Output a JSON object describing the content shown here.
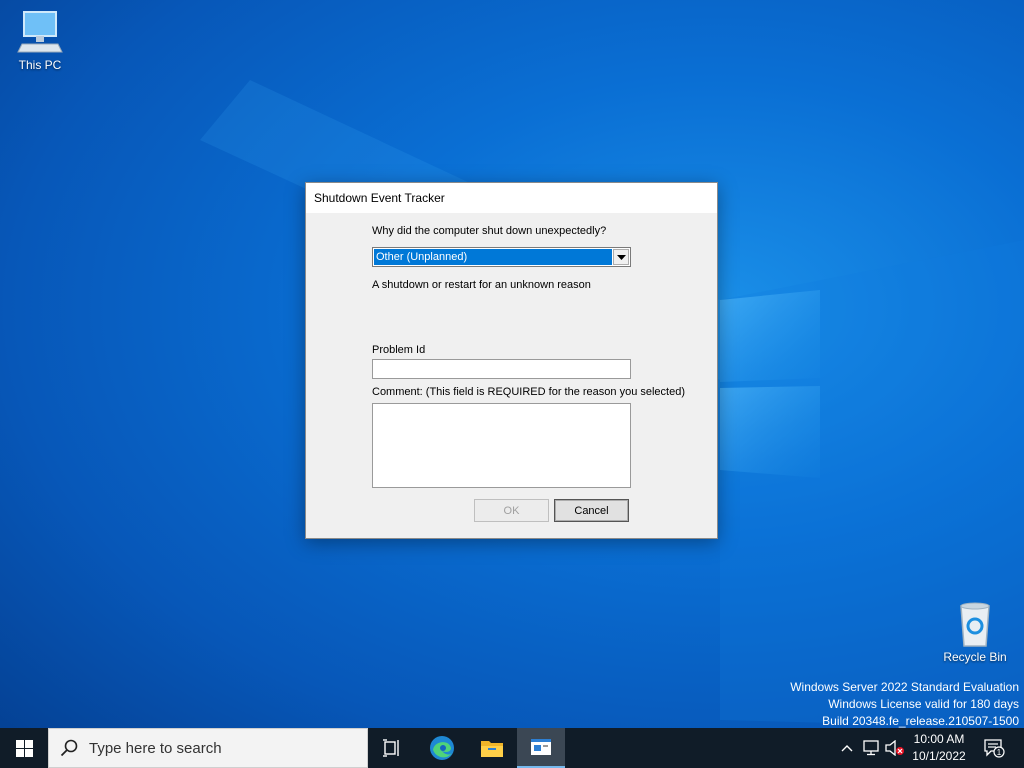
{
  "desktop": {
    "icons": [
      {
        "label": "This PC"
      },
      {
        "label": "Recycle Bin"
      }
    ],
    "watermark": [
      "Windows Server 2022 Standard Evaluation",
      "Windows License valid for 180 days",
      "Build 20348.fe_release.210507-1500"
    ]
  },
  "dialog": {
    "title": "Shutdown Event Tracker",
    "question": "Why did the computer shut down unexpectedly?",
    "reason_selected": "Other (Unplanned)",
    "reason_description": "A shutdown or restart for an unknown reason",
    "problem_id_label": "Problem Id",
    "problem_id_value": "",
    "comment_label": "Comment: (This field is REQUIRED for the reason you selected)",
    "comment_value": "",
    "ok_label": "OK",
    "cancel_label": "Cancel"
  },
  "taskbar": {
    "search_placeholder": "Type here to search",
    "apps": [
      "task-view-icon",
      "edge-icon",
      "file-explorer-icon",
      "shutdown-tracker-icon"
    ],
    "tray_icons": [
      "chevron-up-icon",
      "network-icon",
      "volume-muted-icon"
    ],
    "time": "10:00 AM",
    "date": "10/1/2022",
    "notification_count": "1"
  },
  "colors": {
    "desktop_blue": "#0a6fd4",
    "taskbar": "#101c28",
    "selection": "#0078d7"
  }
}
